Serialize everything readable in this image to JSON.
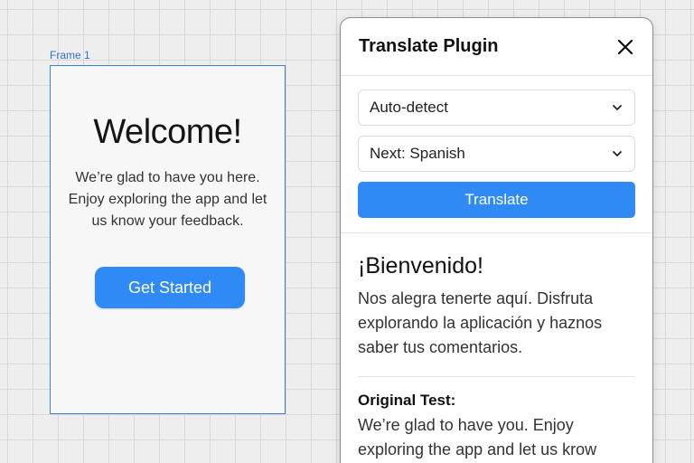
{
  "canvas": {
    "frame_label": "Frame 1"
  },
  "frame": {
    "title": "Welcome!",
    "body": "We’re glad to have you here. Enjoy exploring the app and let us know your feedback.",
    "button_label": "Get Started",
    "button_color": "#2f8af5"
  },
  "plugin": {
    "title": "Translate Plugin",
    "close_icon": "close-icon",
    "source_select": {
      "value": "Auto-detect",
      "icon": "chevron-down-icon"
    },
    "target_select": {
      "value": "Next: Spanish",
      "icon": "chevron-down-icon"
    },
    "translate_label": "Translate",
    "result": {
      "title": "¡Bienvenido!",
      "body": "Nos alegra tenerte aquí. Disfruta explorando la aplicación y haznos saber tus comentarios."
    },
    "original": {
      "label": "Original Test:",
      "body": "We’re glad to have you. Enjoy exploring the app and let us krow"
    },
    "accent_color": "#2f8af5"
  }
}
